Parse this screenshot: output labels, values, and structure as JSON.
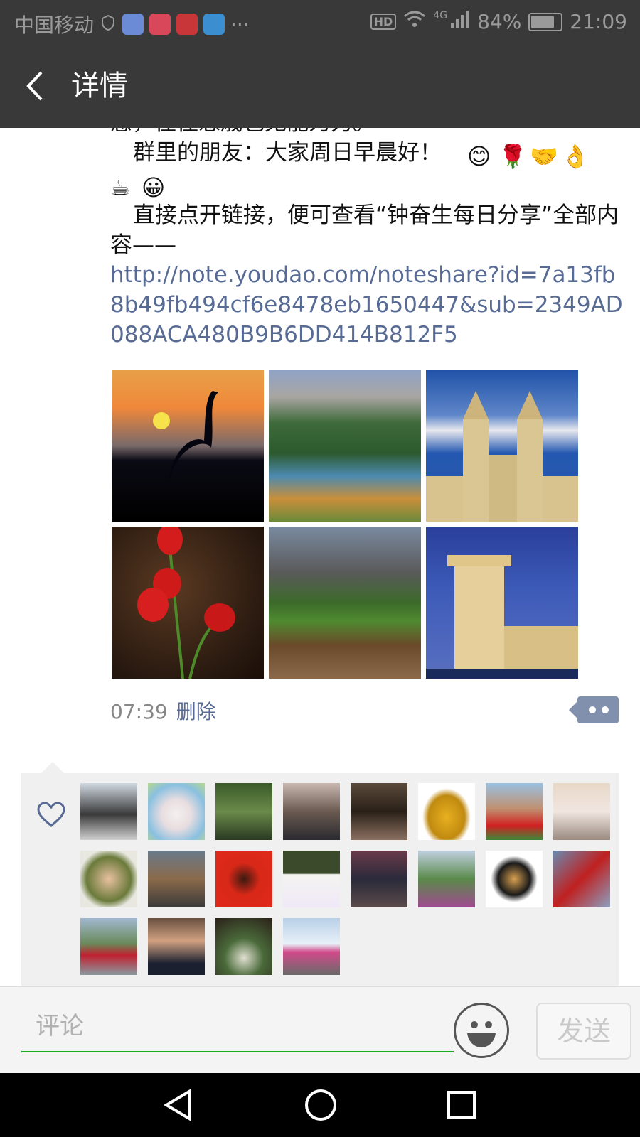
{
  "status_bar": {
    "carrier": "中国移动",
    "more": "···",
    "hd": "HD",
    "network": "4G",
    "battery": "84%",
    "time": "21:09"
  },
  "header": {
    "title": "详情"
  },
  "post": {
    "clipped_line": "感，往往悲戚也无能为力。",
    "greeting": "群里的朋友：大家周日早晨好！",
    "greeting_emojis": [
      "😊",
      "🌹",
      "🤝",
      "👌",
      "☕",
      "😀"
    ],
    "instruction": "直接点开链接，便可查看“钟奋生每日分享”全部内容——",
    "link": "http://note.youdao.com/noteshare?id=7a13fb8b49fb494cf6e8478eb1650447&sub=2349AD088ACA480B9B6DD414B812F5",
    "images": [
      "crane-sunset-photo",
      "mountain-lake-photo",
      "cathedral-towers-photo",
      "red-tulips-photo",
      "mountain-stream-photo",
      "belem-tower-photo"
    ],
    "time": "07:39",
    "delete_label": "删除"
  },
  "likes": {
    "count": 20
  },
  "comment_bar": {
    "placeholder": "评论",
    "send_label": "发送"
  },
  "colors": {
    "header_bg": "#393939",
    "link": "#576b95",
    "input_underline": "#1aad19"
  }
}
